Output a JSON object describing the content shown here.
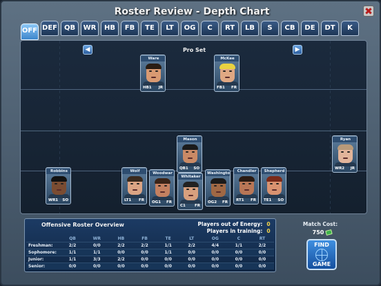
{
  "window": {
    "title": "Roster Review - Depth Chart",
    "close_label": "✖"
  },
  "tabs": [
    "OFF",
    "DEF",
    "QB",
    "WR",
    "HB",
    "FB",
    "TE",
    "LT",
    "OG",
    "C",
    "RT",
    "LB",
    "S",
    "CB",
    "DE",
    "DT",
    "K"
  ],
  "active_tab": "OFF",
  "formation": {
    "label": "Pro Set",
    "prev_label": "◀",
    "next_label": "▶"
  },
  "players": [
    {
      "name": "Ware",
      "pos": "HB1",
      "year": "JR",
      "skin": "#d99a72",
      "hair": "#2a1d14"
    },
    {
      "name": "McKee",
      "pos": "FB1",
      "year": "FR",
      "skin": "#e0a883",
      "hair": "#e8d240"
    },
    {
      "name": "Mason",
      "pos": "QB1",
      "year": "SO",
      "skin": "#c98a66",
      "hair": "#1b1b1b"
    },
    {
      "name": "Ryan",
      "pos": "WR2",
      "year": "JR",
      "skin": "#e2b49a",
      "hair": "#b89a7a"
    },
    {
      "name": "Robbins",
      "pos": "WR1",
      "year": "SO",
      "skin": "#7a4c32",
      "hair": "#111111"
    },
    {
      "name": "Wolf",
      "pos": "LT1",
      "year": "FR",
      "skin": "#dba484",
      "hair": "#3a2a1e"
    },
    {
      "name": "Woodwar",
      "pos": "OG1",
      "year": "FR",
      "skin": "#c48060",
      "hair": "#3b2418"
    },
    {
      "name": "Whitaker",
      "pos": "C1",
      "year": "FR",
      "skin": "#d7a07e",
      "hair": "#222222"
    },
    {
      "name": "Washingto",
      "pos": "OG2",
      "year": "FR",
      "skin": "#a06844",
      "hair": "#1a1a1a"
    },
    {
      "name": "Chandler",
      "pos": "RT1",
      "year": "FR",
      "skin": "#b97656",
      "hair": "#2a1a12"
    },
    {
      "name": "Shepherd",
      "pos": "TE1",
      "year": "SO",
      "skin": "#d99270",
      "hair": "#7a2a1a"
    }
  ],
  "overview": {
    "title": "Offensive Roster Overview",
    "energy_label": "Players out of Energy:",
    "energy_value": "0",
    "training_label": "Players in training:",
    "training_value": "0",
    "columns": [
      "QB",
      "WR",
      "HB",
      "FB",
      "TE",
      "LT",
      "OG",
      "C",
      "RT"
    ],
    "rows": [
      {
        "label": "Freshman:",
        "values": [
          "2/2",
          "0/0",
          "2/2",
          "2/2",
          "1/1",
          "2/2",
          "4/4",
          "1/1",
          "2/2"
        ]
      },
      {
        "label": "Sophomore:",
        "values": [
          "1/1",
          "1/1",
          "0/0",
          "0/0",
          "1/1",
          "0/0",
          "0/0",
          "0/0",
          "0/0"
        ]
      },
      {
        "label": "Junior:",
        "values": [
          "1/1",
          "3/3",
          "2/2",
          "0/0",
          "0/0",
          "0/0",
          "0/0",
          "0/0",
          "0/0"
        ]
      },
      {
        "label": "Senior:",
        "values": [
          "0/0",
          "0/0",
          "0/0",
          "0/0",
          "0/0",
          "0/0",
          "0/0",
          "0/0",
          "0/0"
        ]
      }
    ]
  },
  "match": {
    "cost_label": "Match Cost:",
    "cost_value": "750",
    "find_line1": "FIND",
    "find_line2": "GAME"
  }
}
